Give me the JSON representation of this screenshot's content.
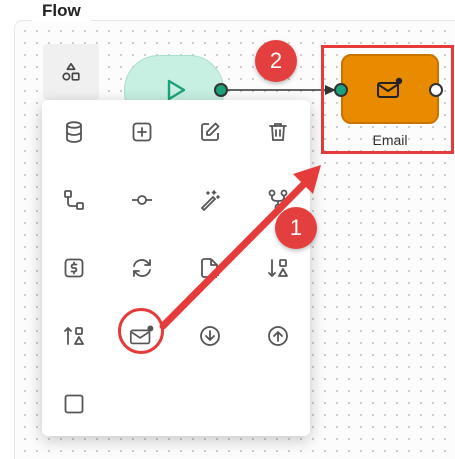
{
  "canvas": {
    "title": "Flow"
  },
  "nodes": {
    "start": {
      "icon": "play-icon"
    },
    "email": {
      "label": "Email",
      "icon": "mail-badge-icon",
      "color": "#e98b00"
    }
  },
  "left_tab": {
    "icon": "shapes-icon"
  },
  "popup_items": [
    {
      "icon": "database-icon"
    },
    {
      "icon": "plus-square-icon"
    },
    {
      "icon": "pencil-square-icon"
    },
    {
      "icon": "trash-icon"
    },
    {
      "icon": "route-icon"
    },
    {
      "icon": "commit-icon"
    },
    {
      "icon": "magic-wand-icon"
    },
    {
      "icon": "git-fork-icon"
    },
    {
      "icon": "dollar-square-icon"
    },
    {
      "icon": "refresh-icon"
    },
    {
      "icon": "file-plus-icon"
    },
    {
      "icon": "sort-down-shapes-icon"
    },
    {
      "icon": "sort-up-shapes-icon"
    },
    {
      "icon": "mail-badge-icon"
    },
    {
      "icon": "arrow-down-circle-icon"
    },
    {
      "icon": "arrow-up-circle-icon"
    },
    {
      "icon": "square-icon"
    }
  ],
  "annotations": {
    "step1": "1",
    "step2": "2",
    "highlight_color": "#e53b3b"
  }
}
